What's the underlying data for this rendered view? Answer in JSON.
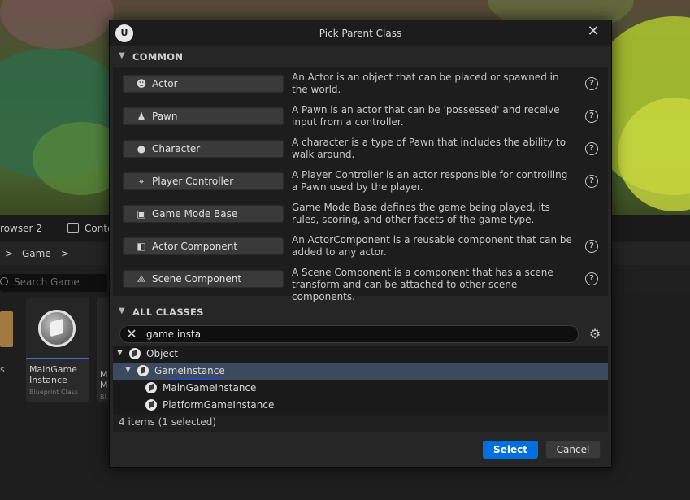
{
  "background": {
    "tabs": [
      {
        "label": "rowser 2"
      },
      {
        "label": "Conte"
      }
    ],
    "path": {
      "root_chevron": ">",
      "folder": "Game",
      "chevron": ">"
    },
    "search_placeholder": "Search Game",
    "assets": [
      {
        "name": "MainGame Instance",
        "type": "Blueprint Class"
      },
      {
        "name_partial_1": "M",
        "name_partial_2": "M",
        "type_partial": "Bl"
      }
    ],
    "left_stub": "s"
  },
  "dialog": {
    "logo": "U",
    "title": "Pick Parent Class",
    "close_glyph": "✕",
    "common": {
      "header": "COMMON",
      "items": [
        {
          "icon": "actor-icon",
          "label": "Actor",
          "description": "An Actor is an object that can be placed or spawned in the world.",
          "has_help": true
        },
        {
          "icon": "pawn-icon",
          "label": "Pawn",
          "description": "A Pawn is an actor that can be 'possessed' and receive input from a controller.",
          "has_help": true
        },
        {
          "icon": "character-icon",
          "label": "Character",
          "description": "A character is a type of Pawn that includes the ability to walk around.",
          "has_help": true
        },
        {
          "icon": "gamepad-icon",
          "label": "Player Controller",
          "description": "A Player Controller is an actor responsible for controlling a Pawn used by the player.",
          "has_help": true
        },
        {
          "icon": "game-mode-icon",
          "label": "Game Mode Base",
          "description": "Game Mode Base defines the game being played, its rules, scoring, and other facets of the game type.",
          "has_help": false
        },
        {
          "icon": "actor-component-icon",
          "label": "Actor Component",
          "description": "An ActorComponent is a reusable component that can be added to any actor.",
          "has_help": true
        },
        {
          "icon": "scene-component-icon",
          "label": "Scene Component",
          "description": "A Scene Component is a component that has a scene transform and can be attached to other scene components.",
          "has_help": true
        }
      ]
    },
    "all_classes": {
      "header": "ALL CLASSES",
      "search_value": "game insta",
      "tree": [
        {
          "label": "Object",
          "expanded": true,
          "selected": false
        },
        {
          "label": "GameInstance",
          "expanded": true,
          "selected": true
        },
        {
          "label": "MainGameInstance",
          "expanded": false,
          "selected": false
        },
        {
          "label": "PlatformGameInstance",
          "expanded": false,
          "selected": false
        }
      ],
      "status": "4 items (1 selected)"
    },
    "buttons": {
      "select": "Select",
      "cancel": "Cancel"
    },
    "colors": {
      "accent": "#0070e0",
      "selection": "#3b4a5c"
    }
  }
}
